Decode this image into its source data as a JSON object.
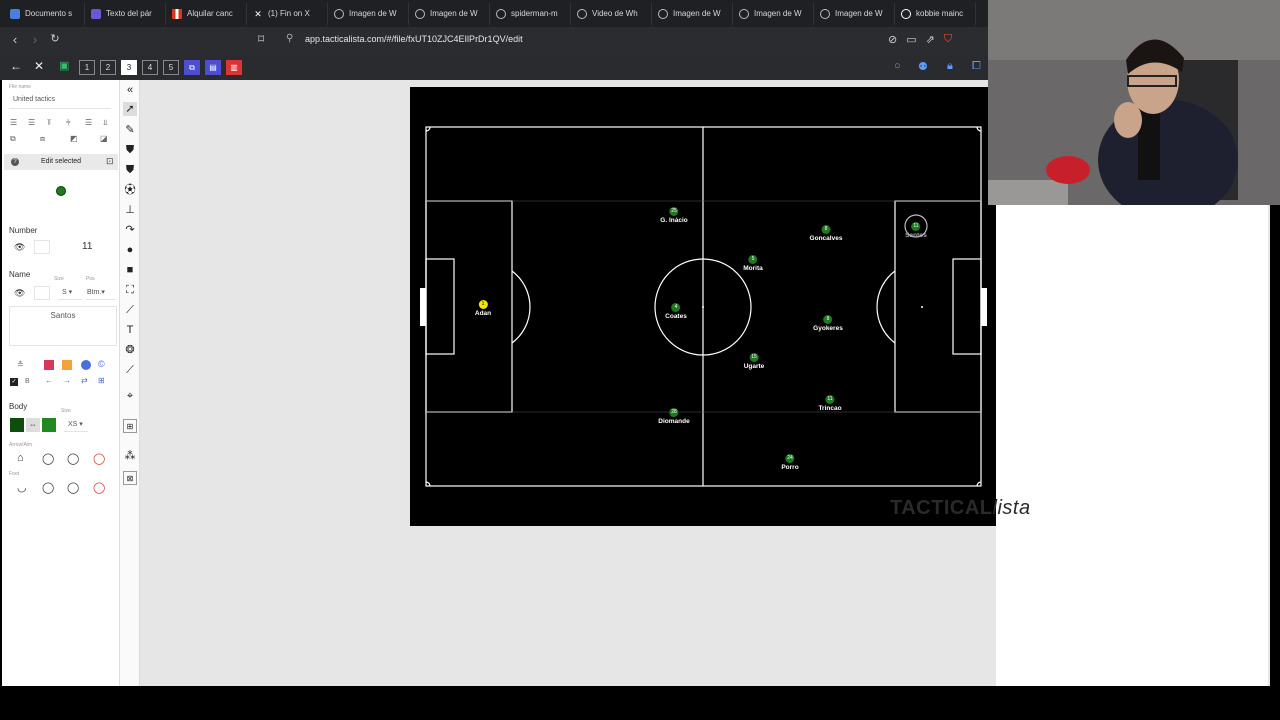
{
  "browser": {
    "tabs": [
      {
        "label": "Documento s",
        "icon": "doc-icon"
      },
      {
        "label": "Texto del pár",
        "icon": "shield-icon"
      },
      {
        "label": "Alquilar canc",
        "icon": "flag-icon"
      },
      {
        "label": "(1) Fin on X",
        "icon": "x-icon"
      },
      {
        "label": "Imagen de W",
        "icon": "globe-icon"
      },
      {
        "label": "Imagen de W",
        "icon": "globe-icon"
      },
      {
        "label": "spiderman-m",
        "icon": "globe-icon"
      },
      {
        "label": "Video de Wh",
        "icon": "globe-icon"
      },
      {
        "label": "Imagen de W",
        "icon": "globe-icon"
      },
      {
        "label": "Imagen de W",
        "icon": "globe-icon"
      },
      {
        "label": "Imagen de W",
        "icon": "globe-icon"
      },
      {
        "label": "kobbie mainc",
        "icon": "google-icon"
      }
    ],
    "url": "app.tacticalista.com/#/file/fxUT10ZJC4EIlPrDr1QV/edit"
  },
  "toolbar": {
    "slots": [
      "1",
      "2",
      "3",
      "4",
      "5"
    ],
    "active_slot": "3"
  },
  "sidebar": {
    "file_name_label": "File name",
    "file_name": "United tactics",
    "edit_selected": "Edit selected",
    "number_label": "Number",
    "number_value": "11",
    "name_label": "Name",
    "size_label": "Size",
    "pos_label": "Pos",
    "size_value": "S",
    "pos_value": "Btm.",
    "name_value": "Santos",
    "bold_label": "B",
    "body_label": "Body",
    "body_size_label": "Size",
    "body_size_value": "XS",
    "arrow_label": "Arrow/Aim",
    "foot_label": "Foot",
    "colors": {
      "red": "#d7375c",
      "orange": "#f4a23a",
      "blue": "#4d6fd8",
      "dark_green": "#0e4d0e",
      "green": "#1f8a1f"
    }
  },
  "pitch": {
    "brand": "TACTICAL",
    "brand_italic": "lista",
    "players": [
      {
        "number": "1",
        "name": "Adan",
        "gk": true
      },
      {
        "number": "25",
        "name": "G. Inácio",
        "gk": false
      },
      {
        "number": "4",
        "name": "Coates",
        "gk": false
      },
      {
        "number": "5",
        "name": "Morita",
        "gk": false
      },
      {
        "number": "15",
        "name": "Ugarte",
        "gk": false
      },
      {
        "number": "28",
        "name": "Diomande",
        "gk": false
      },
      {
        "number": "8",
        "name": "Goncalves",
        "gk": false
      },
      {
        "number": "8",
        "name": "Gyokeres",
        "gk": false
      },
      {
        "number": "11",
        "name": "Trincao",
        "gk": false
      },
      {
        "number": "24",
        "name": "Porro",
        "gk": false
      },
      {
        "number": "11",
        "name": "Santos",
        "gk": false
      }
    ]
  }
}
